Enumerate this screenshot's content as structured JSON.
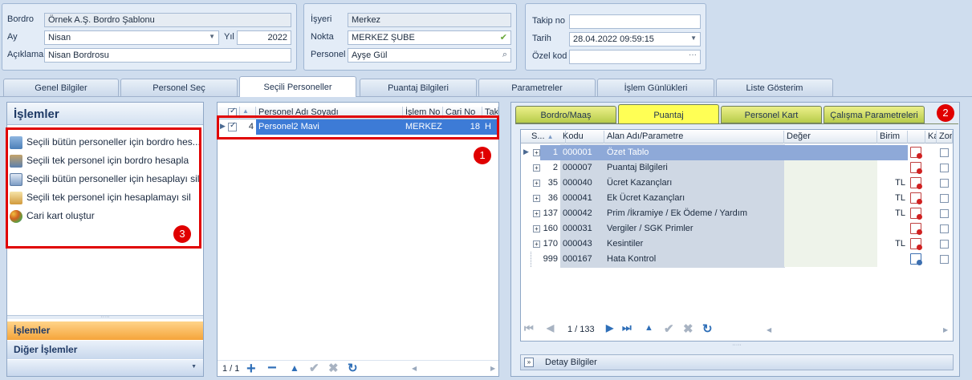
{
  "header": {
    "group1": {
      "bordro_label": "Bordro",
      "bordro_value": "Örnek A.Ş. Bordro Şablonu",
      "ay_label": "Ay",
      "ay_value": "Nisan",
      "yil_label": "Yıl",
      "yil_value": "2022",
      "aciklama_label": "Açıklama",
      "aciklama_value": "Nisan Bordrosu"
    },
    "group2": {
      "isyeri_label": "İşyeri",
      "isyeri_value": "Merkez",
      "nokta_label": "Nokta",
      "nokta_value": "MERKEZ ŞUBE",
      "personel_label": "Personel",
      "personel_value": "Ayşe Gül"
    },
    "group3": {
      "takip_label": "Takip no",
      "takip_value": "",
      "tarih_label": "Tarih",
      "tarih_value": "28.04.2022 09:59:15",
      "ozel_label": "Özel kod",
      "ozel_value": ""
    }
  },
  "main_tabs": [
    "Genel Bilgiler",
    "Personel Seç",
    "Seçili Personeller",
    "Puantaj Bilgileri",
    "Parametreler",
    "İşlem Günlükleri",
    "Liste Gösterim"
  ],
  "sidebar": {
    "title": "İşlemler",
    "items": [
      {
        "label": "Seçili bütün personeller için bordro hes...",
        "icon": "calculator-users-icon"
      },
      {
        "label": "Seçili tek personel için bordro hesapla",
        "icon": "calculator-user-icon"
      },
      {
        "label": "Seçili bütün personeller için hesaplayı sil",
        "icon": "id-card-icon"
      },
      {
        "label": "Seçili tek personel için hesaplamayı sil",
        "icon": "calendar-delete-icon"
      },
      {
        "label": "Cari kart oluştur",
        "icon": "cards-icon"
      }
    ],
    "bottom": {
      "islemler": "İşlemler",
      "diger": "Diğer İşlemler"
    }
  },
  "personnel_grid": {
    "columns": [
      "Personel Adı Soyadı",
      "İşlem No",
      "Cari No",
      "Tak"
    ],
    "rows": [
      {
        "index": "4",
        "name": "Personel2 Mavi",
        "islem_no": "MERKEZ :",
        "cari_no": "18",
        "tak": "H",
        "checked": true
      }
    ],
    "pager": "1 / 1"
  },
  "sub_tabs": [
    "Bordro/Maaş",
    "Puantaj",
    "Personel Kart",
    "Çalışma Parametreleri"
  ],
  "param_grid": {
    "columns": [
      "S...",
      "Kodu",
      "Alan Adı/Parametre",
      "Değer",
      "Birim",
      "",
      "Ka",
      "Zor"
    ],
    "rows": [
      {
        "s": "1",
        "kodu": "000001",
        "alan": "Özet Tablo",
        "birim": "",
        "icon": "red"
      },
      {
        "s": "2",
        "kodu": "000007",
        "alan": "Puantaj Bilgileri",
        "birim": "",
        "icon": "red"
      },
      {
        "s": "35",
        "kodu": "000040",
        "alan": "Ücret Kazançları",
        "birim": "TL",
        "icon": "red"
      },
      {
        "s": "36",
        "kodu": "000041",
        "alan": "Ek Ücret Kazançları",
        "birim": "TL",
        "icon": "red"
      },
      {
        "s": "137",
        "kodu": "000042",
        "alan": "Prim /İkramiye / Ek Ödeme / Yardım",
        "birim": "TL",
        "icon": "red"
      },
      {
        "s": "160",
        "kodu": "000031",
        "alan": "Vergiler / SGK Primler",
        "birim": "",
        "icon": "red"
      },
      {
        "s": "170",
        "kodu": "000043",
        "alan": "Kesintiler",
        "birim": "TL",
        "icon": "red"
      },
      {
        "s": "999",
        "kodu": "000167",
        "alan": "Hata Kontrol",
        "birim": "",
        "icon": "blue"
      }
    ],
    "pager": "1 / 133",
    "detail_label": "Detay Bilgiler"
  },
  "badges": [
    "1",
    "2",
    "3"
  ],
  "colors": {
    "selection": "#3d7bd6",
    "highlight_row": "#8ea9d8",
    "red": "#e00000",
    "yellow_tab": "#ffff55"
  }
}
